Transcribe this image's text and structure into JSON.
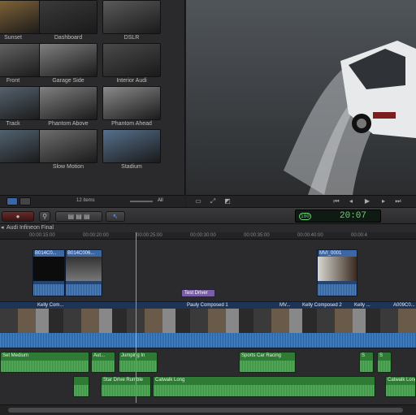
{
  "browser": {
    "clips": [
      {
        "label": "Sunset",
        "color": "#8a6a3a"
      },
      {
        "label": "Dashboard",
        "color": "#3a3a3a"
      },
      {
        "label": "DSLR",
        "color": "#5a5a5a"
      },
      {
        "label": "Front",
        "color": "#6a6a6a"
      },
      {
        "label": "Garage Side",
        "color": "#7f7f7f"
      },
      {
        "label": "Interior Audi",
        "color": "#4a4a4a"
      },
      {
        "label": "Track",
        "color": "#5c6a78"
      },
      {
        "label": "Phantom Above",
        "color": "#808080"
      },
      {
        "label": "Phantom Ahead",
        "color": "#8a8a8a"
      },
      {
        "label": "",
        "color": "#586a7a"
      },
      {
        "label": "Slow Motion",
        "color": "#6e6e6e"
      },
      {
        "label": "Stadium",
        "color": "#56708c"
      }
    ],
    "item_count": "12 items",
    "all_label": "All"
  },
  "timecode": "20:07",
  "timeline": {
    "project_name": "Audi Infineon Final",
    "ruler_ticks": [
      "00:00:15:00",
      "00:00:20:00",
      "00:00:25:00",
      "00:00:30:00",
      "00:00:35:00",
      "00:00:40:00",
      "00:00:4"
    ],
    "connected_clips": [
      "B014C0...",
      "B014C006...",
      "MVI_0001"
    ],
    "title_clip": "Test Driver",
    "primary_labels": [
      "Kelly Com...",
      "Pauly Composed 1",
      "MV...",
      "Kelly Composed 2",
      "Kelly ...",
      "A009C0..."
    ],
    "audio_labels": [
      "Set Medium",
      "Aut...",
      "Jumping In",
      "Sports Car Racing",
      "S",
      "S",
      "Star Drive Rumble",
      "Catwalk Long",
      "Catwalk Long"
    ]
  }
}
